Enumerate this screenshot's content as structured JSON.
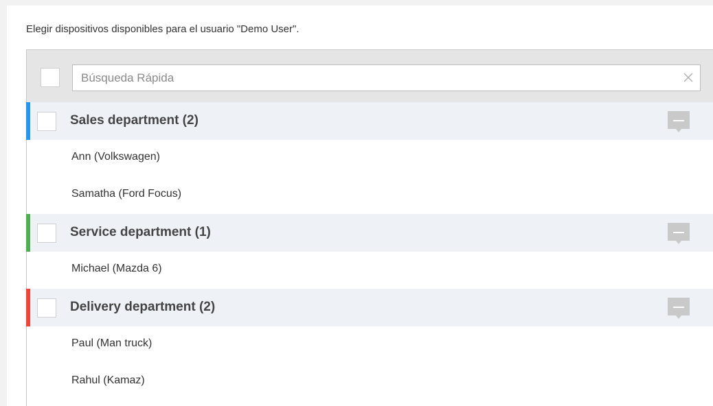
{
  "instruction": "Elegir dispositivos disponibles para el usuario \"Demo User\".",
  "search": {
    "placeholder": "Búsqueda Rápida",
    "value": "",
    "clear_icon": "close-icon"
  },
  "colors": {
    "sales": "#2196f3",
    "service": "#4caf50",
    "delivery": "#f44336",
    "group_bg": "#eef2f6",
    "search_bar_bg": "#e5e5e5"
  },
  "groups": [
    {
      "label": "Sales department (2)",
      "color": "#2196f3",
      "comment_icon": "comment-icon",
      "devices": [
        "Ann (Volkswagen)",
        "Samatha (Ford Focus)"
      ]
    },
    {
      "label": "Service department (1)",
      "color": "#4caf50",
      "comment_icon": "comment-icon",
      "devices": [
        "Michael (Mazda 6)"
      ]
    },
    {
      "label": "Delivery department (2)",
      "color": "#f44336",
      "comment_icon": "comment-icon",
      "devices": [
        "Paul (Man truck)",
        "Rahul (Kamaz)"
      ]
    }
  ]
}
